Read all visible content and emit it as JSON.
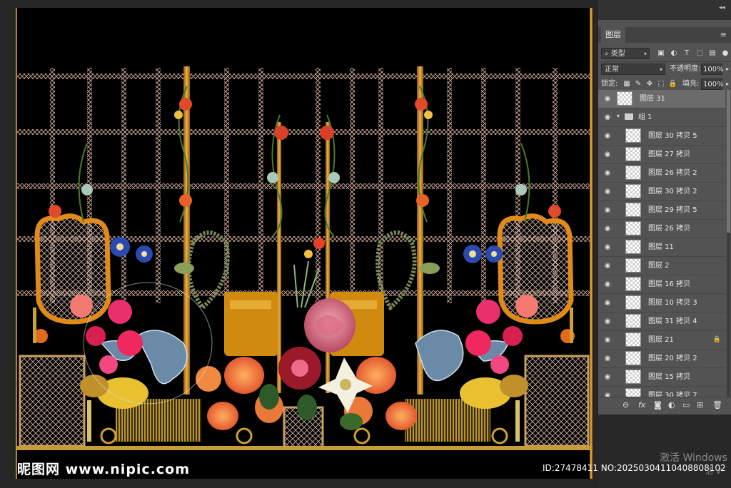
{
  "watermark": {
    "site": "昵图网 www.nipic.com",
    "id_text": "ID:27478411 NO:20250304110408808102"
  },
  "system_overlay": {
    "activate_line1": "激活 Windows",
    "activate_line2": "活 V"
  },
  "panel": {
    "tab_label": "图层",
    "filter_kind": "类型",
    "blend_mode": "正常",
    "opacity_label": "不透明度:",
    "opacity_value": "100%",
    "lock_label": "锁定:",
    "fill_label": "填充:",
    "fill_value": "100%",
    "layers": [
      {
        "name": "图层 31",
        "type": "layer",
        "selected": true
      },
      {
        "name": "组 1",
        "type": "group"
      },
      {
        "name": "图层 30 拷贝 5",
        "type": "layer"
      },
      {
        "name": "图层 27 拷贝",
        "type": "layer"
      },
      {
        "name": "图层 26 拷贝 2",
        "type": "layer"
      },
      {
        "name": "图层 30 拷贝 2",
        "type": "layer"
      },
      {
        "name": "图层 29 拷贝 5",
        "type": "layer"
      },
      {
        "name": "图层 26 拷贝",
        "type": "layer"
      },
      {
        "name": "图层 11",
        "type": "layer"
      },
      {
        "name": "图层 2",
        "type": "layer"
      },
      {
        "name": "图层 16 拷贝",
        "type": "layer"
      },
      {
        "name": "图层 10 拷贝 3",
        "type": "layer"
      },
      {
        "name": "图层 31 拷贝 4",
        "type": "layer"
      },
      {
        "name": "图层 21",
        "type": "layer",
        "locked": true
      },
      {
        "name": "图层 20 拷贝 2",
        "type": "layer"
      },
      {
        "name": "图层 15 拷贝",
        "type": "layer"
      },
      {
        "name": "图层 30 拷贝 7",
        "type": "layer"
      }
    ],
    "bottom_icons": [
      "link-icon",
      "fx-icon",
      "mask-icon",
      "adjustment-icon",
      "folder-icon",
      "new-layer-icon",
      "trash-icon"
    ]
  }
}
